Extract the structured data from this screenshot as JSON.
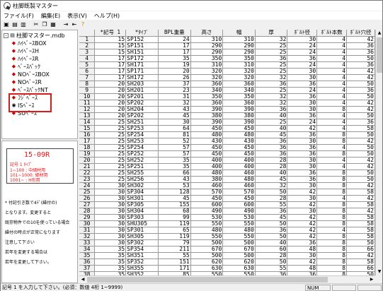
{
  "window": {
    "title": "柱脚既製マスター"
  },
  "menu": [
    "ファイル(F)",
    "編集(E)",
    "表示(V)",
    "ヘルプ(H)"
  ],
  "toolbar": [
    "save-icon",
    "open-icon",
    "print-icon",
    "cut-icon",
    "copy-icon",
    "paste-icon",
    "insert-row-icon",
    "delete-row-icon",
    "help-icon"
  ],
  "tree": {
    "root": "柱脚マスター.mdb",
    "items": [
      "ﾊｲﾍﾞｰｽBOX",
      "ﾊｲﾍﾞｰｽH",
      "ﾊｲﾍﾞｰｽR",
      "ﾍﾞｰｽﾊﾟｯｸ",
      "NOﾍﾞｰｽBOX",
      "NOﾍﾞｰｽR",
      "ﾍﾞｰｽﾊﾟｯｸNT",
      "ﾌｼﾞﾍﾞｰｽ",
      "ISﾍﾞｰｽ",
      "SUﾍﾞｰｽ"
    ]
  },
  "memo": {
    "code": "15-09R",
    "card_lines": [
      "記号 1 ﾀｲﾌﾟ",
      "1~100  : 中細材用",
      "101~1000: 細材用",
      "1001~   : H形用"
    ],
    "notes": [
      "* 付記引き数で4ﾃﾞ(繰付の)",
      "となります。変更すると",
      "既存物件での10を使っている場合",
      "繰付の時点が正常になります",
      "注意して下さい",
      "若年を変更する場合は",
      "若年を変更して下さい。"
    ]
  },
  "grid": {
    "headers": [
      "",
      "*記号 1",
      "*ﾀｲﾌﾟ",
      "BPL重量",
      "高さ",
      "幅",
      "厚",
      "ﾎﾞﾙﾄ径",
      "ﾎﾞﾙﾄ本数",
      "ﾎﾞﾙﾄ穴径"
    ],
    "rows": [
      [
        "1",
        "15",
        "SP152",
        "24",
        "310",
        "310",
        "32",
        "30",
        "4",
        "42"
      ],
      [
        "2",
        "15",
        "SP151",
        "17",
        "290",
        "290",
        "25",
        "24",
        "4",
        "36"
      ],
      [
        "3",
        "15",
        "SH151",
        "17",
        "290",
        "290",
        "25",
        "24",
        "4",
        "36"
      ],
      [
        "4",
        "17",
        "SP172",
        "35",
        "350",
        "350",
        "36",
        "36",
        "4",
        "50"
      ],
      [
        "5",
        "17",
        "SH171",
        "19",
        "310",
        "310",
        "25",
        "24",
        "4",
        "36"
      ],
      [
        "6",
        "17",
        "SP171",
        "20",
        "320",
        "320",
        "25",
        "30",
        "4",
        "42"
      ],
      [
        "7",
        "17",
        "SH172",
        "26",
        "320",
        "320",
        "32",
        "30",
        "4",
        "42"
      ],
      [
        "8",
        "20",
        "SH203",
        "37",
        "360",
        "360",
        "36",
        "36",
        "4",
        "50"
      ],
      [
        "9",
        "20",
        "SH201",
        "23",
        "340",
        "340",
        "25",
        "24",
        "4",
        "36"
      ],
      [
        "10",
        "20",
        "SP201",
        "31",
        "350",
        "350",
        "32",
        "36",
        "4",
        "50"
      ],
      [
        "11",
        "20",
        "SP202",
        "32",
        "360",
        "360",
        "32",
        "30",
        "4",
        "42"
      ],
      [
        "12",
        "20",
        "SH204",
        "43",
        "390",
        "390",
        "36",
        "30",
        "8",
        "42"
      ],
      [
        "13",
        "20",
        "SP202",
        "45",
        "380",
        "380",
        "40",
        "36",
        "4",
        "50"
      ],
      [
        "14",
        "25",
        "SH251",
        "30",
        "390",
        "390",
        "25",
        "24",
        "4",
        "36"
      ],
      [
        "15",
        "25",
        "SP253",
        "64",
        "450",
        "450",
        "40",
        "42",
        "4",
        "58"
      ],
      [
        "16",
        "25",
        "SP254",
        "81",
        "480",
        "480",
        "45",
        "36",
        "8",
        "50"
      ],
      [
        "17",
        "25",
        "SH253",
        "52",
        "430",
        "430",
        "36",
        "30",
        "8",
        "42"
      ],
      [
        "18",
        "25",
        "SP254",
        "57",
        "450",
        "450",
        "36",
        "36",
        "4",
        "50"
      ],
      [
        "19",
        "25",
        "SP252",
        "57",
        "450",
        "450",
        "36",
        "36",
        "8",
        "50"
      ],
      [
        "20",
        "25",
        "SH252",
        "35",
        "400",
        "400",
        "28",
        "30",
        "4",
        "42"
      ],
      [
        "21",
        "25",
        "SP251",
        "35",
        "400",
        "400",
        "28",
        "30",
        "4",
        "42"
      ],
      [
        "22",
        "25",
        "SH255",
        "66",
        "480",
        "460",
        "40",
        "36",
        "8",
        "50"
      ],
      [
        "23",
        "25",
        "SH256",
        "43",
        "380",
        "480",
        "45",
        "36",
        "8",
        "50"
      ],
      [
        "24",
        "30",
        "SH302",
        "53",
        "460",
        "460",
        "32",
        "30",
        "8",
        "42"
      ],
      [
        "25",
        "30",
        "SP304",
        "128",
        "570",
        "570",
        "50",
        "42",
        "8",
        "58"
      ],
      [
        "26",
        "30",
        "SH301",
        "45",
        "450",
        "450",
        "28",
        "30",
        "4",
        "42"
      ],
      [
        "27",
        "30",
        "SP305",
        "155",
        "600",
        "600",
        "55",
        "42",
        "8",
        "58"
      ],
      [
        "28",
        "30",
        "SH304",
        "68",
        "490",
        "490",
        "36",
        "30",
        "8",
        "42"
      ],
      [
        "29",
        "30",
        "SP303",
        "99",
        "530",
        "530",
        "45",
        "42",
        "8",
        "58"
      ],
      [
        "30",
        "30",
        "SHU305",
        "119",
        "550",
        "550",
        "50",
        "42",
        "8",
        "58"
      ],
      [
        "31",
        "30",
        "SP301",
        "65",
        "480",
        "480",
        "36",
        "42",
        "4",
        "58"
      ],
      [
        "32",
        "30",
        "SH305",
        "119",
        "550",
        "550",
        "50",
        "42",
        "8",
        "58"
      ],
      [
        "33",
        "30",
        "SP302",
        "79",
        "500",
        "500",
        "40",
        "36",
        "8",
        "50"
      ],
      [
        "34",
        "35",
        "SP354",
        "211",
        "670",
        "670",
        "60",
        "48",
        "8",
        "66"
      ],
      [
        "35",
        "35",
        "SH351",
        "55",
        "500",
        "500",
        "28",
        "30",
        "8",
        "42"
      ],
      [
        "36",
        "35",
        "SP352",
        "151",
        "620",
        "620",
        "50",
        "42",
        "8",
        "58"
      ],
      [
        "37",
        "35",
        "SH355",
        "171",
        "630",
        "630",
        "55",
        "48",
        "8",
        "66"
      ],
      [
        "38",
        "35",
        "SH352",
        "85",
        "550",
        "550",
        "36",
        "36",
        "8",
        "50"
      ]
    ]
  },
  "status": {
    "message": "記号 1 を入力して下さい。(必須：数値 4桁 1~9999)",
    "indicator": "NUM"
  }
}
